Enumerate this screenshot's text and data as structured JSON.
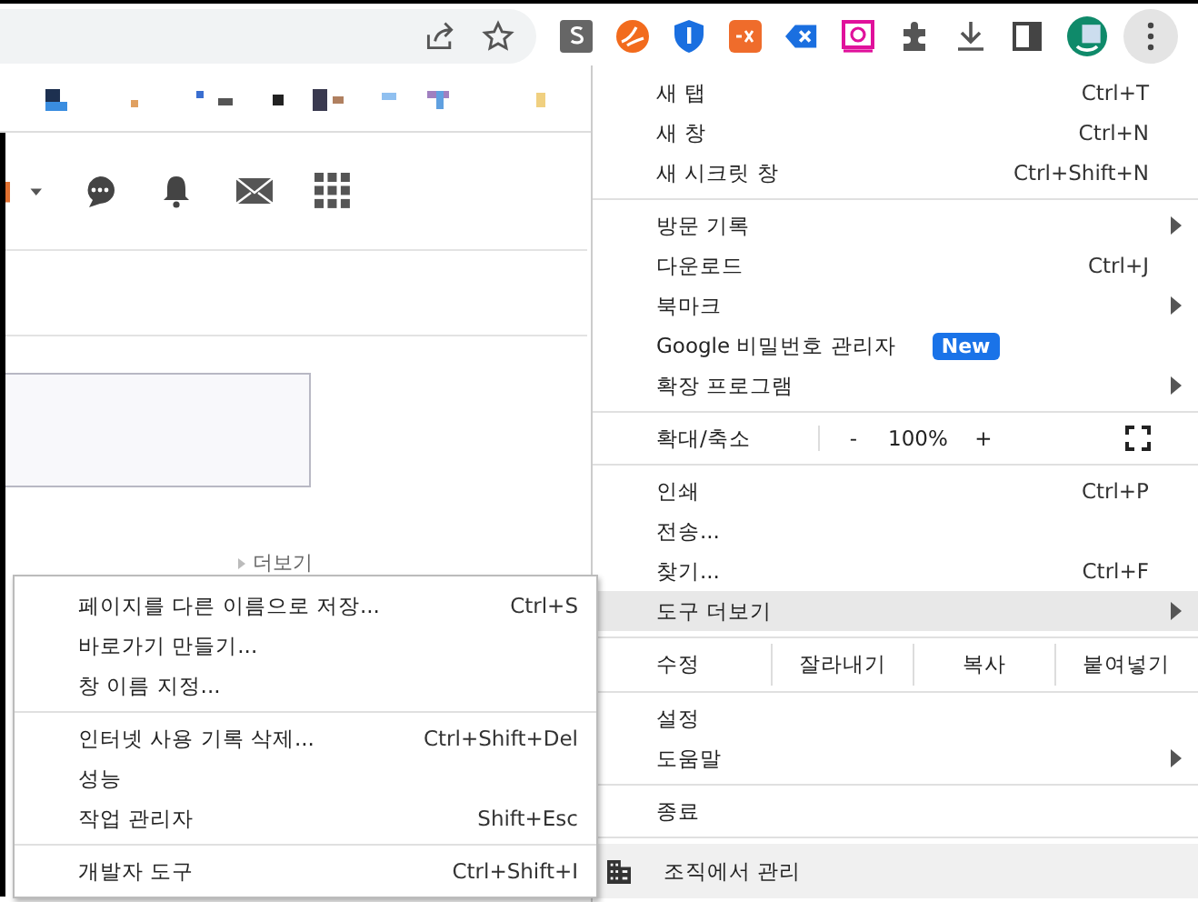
{
  "page": {
    "more_link": "더보기"
  },
  "menu": {
    "groups": [
      [
        {
          "kind": "command",
          "label": "새 탭",
          "shortcut": "Ctrl+T",
          "submenu": false,
          "highlighted": false
        },
        {
          "kind": "command",
          "label": "새 창",
          "shortcut": "Ctrl+N",
          "submenu": false,
          "highlighted": false
        },
        {
          "kind": "command",
          "label": "새 시크릿 창",
          "shortcut": "Ctrl+Shift+N",
          "submenu": false,
          "highlighted": false
        }
      ],
      [
        {
          "kind": "command",
          "label": "방문 기록",
          "submenu": true,
          "highlighted": false
        },
        {
          "kind": "command",
          "label": "다운로드",
          "shortcut": "Ctrl+J",
          "submenu": false,
          "highlighted": false
        },
        {
          "kind": "command",
          "label": "북마크",
          "submenu": true,
          "highlighted": false
        },
        {
          "kind": "command",
          "label": "Google 비밀번호 관리자",
          "badge": "New",
          "submenu": false,
          "highlighted": false
        },
        {
          "kind": "command",
          "label": "확장 프로그램",
          "submenu": true,
          "highlighted": false
        }
      ],
      [
        {
          "kind": "zoom",
          "label": "확대/축소",
          "minus": "-",
          "value": "100%",
          "plus": "+"
        }
      ],
      [
        {
          "kind": "command",
          "label": "인쇄",
          "shortcut": "Ctrl+P",
          "submenu": false,
          "highlighted": false
        },
        {
          "kind": "command",
          "label": "전송...",
          "submenu": false,
          "highlighted": false
        },
        {
          "kind": "command",
          "label": "찾기...",
          "shortcut": "Ctrl+F",
          "submenu": false,
          "highlighted": false
        },
        {
          "kind": "command",
          "label": "도구 더보기",
          "submenu": true,
          "highlighted": true
        }
      ],
      [
        {
          "kind": "edit",
          "label": "수정",
          "buttons": [
            "잘라내기",
            "복사",
            "붙여넣기"
          ]
        }
      ],
      [
        {
          "kind": "command",
          "label": "설정",
          "submenu": false,
          "highlighted": false
        },
        {
          "kind": "command",
          "label": "도움말",
          "submenu": true,
          "highlighted": false
        }
      ],
      [
        {
          "kind": "command",
          "label": "종료",
          "submenu": false,
          "highlighted": false
        }
      ],
      [
        {
          "kind": "managed",
          "label": "조직에서 관리"
        }
      ]
    ]
  },
  "submenu": {
    "groups": [
      [
        {
          "label": "페이지를 다른 이름으로 저장...",
          "shortcut": "Ctrl+S"
        },
        {
          "label": "바로가기 만들기..."
        },
        {
          "label": "창 이름 지정..."
        }
      ],
      [
        {
          "label": "인터넷 사용 기록 삭제...",
          "shortcut": "Ctrl+Shift+Del"
        },
        {
          "label": "성능"
        },
        {
          "label": "작업 관리자",
          "shortcut": "Shift+Esc"
        }
      ],
      [
        {
          "label": "개발자 도구",
          "shortcut": "Ctrl+Shift+I"
        }
      ]
    ]
  }
}
